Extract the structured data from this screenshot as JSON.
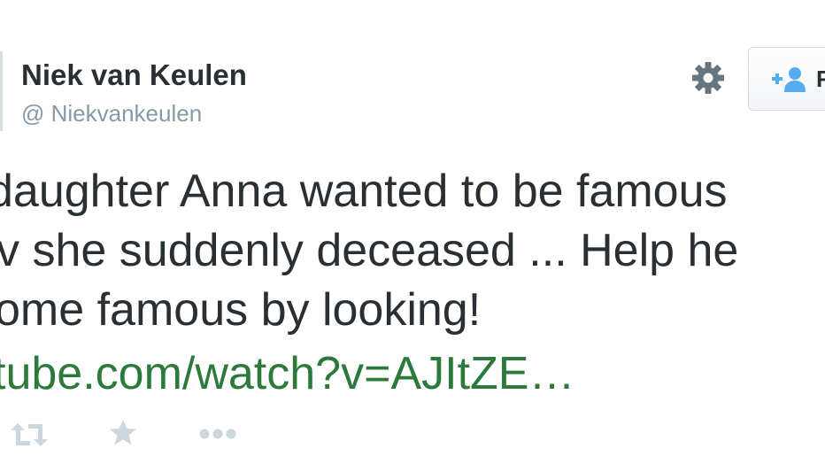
{
  "profile": {
    "name": "Niek van Keulen",
    "handle": "@ Niekvankeulen"
  },
  "header": {
    "settings_icon": "gear-icon",
    "follow_label": "F",
    "follow_icon": "add-user-icon"
  },
  "tweet": {
    "lines": [
      "daughter Anna wanted to be famous",
      "v she suddenly deceased ... Help he",
      "ome famous by looking!"
    ],
    "link": "tube.com/watch?v=AJItZE…"
  },
  "actions": {
    "retweet_icon": "retweet-icon",
    "favorite_icon": "star-icon",
    "more_icon": "more-icon"
  },
  "colors": {
    "text": "#292f33",
    "handle": "#8899a6",
    "link": "#2b7a3b",
    "icon": "#8899a6",
    "action_icon": "#ccd6dd"
  }
}
